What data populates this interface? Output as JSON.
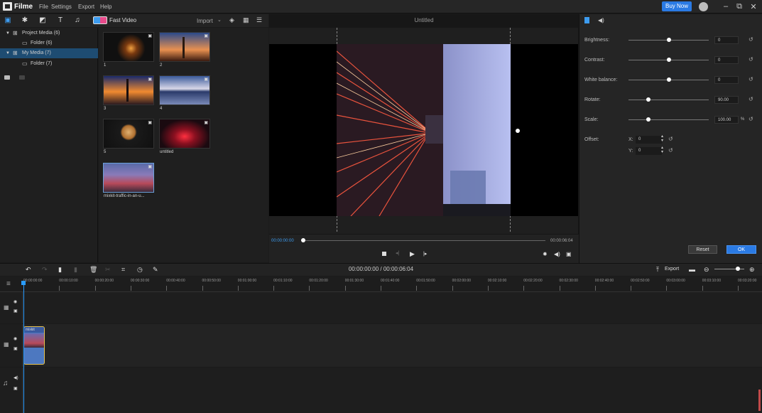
{
  "app": {
    "name": "Filme"
  },
  "menu": [
    {
      "label": "File"
    },
    {
      "label": "Settings"
    },
    {
      "label": "Export"
    },
    {
      "label": "Help"
    }
  ],
  "titlebar": {
    "buy_now": "Buy Now"
  },
  "library": {
    "fast_video": "Fast Video",
    "import": "Import",
    "tree": [
      {
        "label": "Project Media (6)",
        "indent": 0,
        "selected": false
      },
      {
        "label": "Folder (6)",
        "indent": 1,
        "selected": false
      },
      {
        "label": "My Media (7)",
        "indent": 0,
        "selected": true
      },
      {
        "label": "Folder (7)",
        "indent": 1,
        "selected": false
      }
    ],
    "media": [
      {
        "label": "1"
      },
      {
        "label": "2"
      },
      {
        "label": "3"
      },
      {
        "label": "4"
      },
      {
        "label": "5"
      },
      {
        "label": "untitled"
      },
      {
        "label": "mixkit-traffic-in-an-u..."
      }
    ]
  },
  "preview": {
    "title": "Untitled",
    "time_current": "00:00:00:00",
    "time_total": "00:00:06:04",
    "progress": 0.0
  },
  "properties": {
    "brightness": {
      "label": "Brightness:",
      "value": "0",
      "level": 0.5
    },
    "contrast": {
      "label": "Contrast:",
      "value": "0",
      "level": 0.5
    },
    "white_balance": {
      "label": "White balance:",
      "value": "0",
      "level": 0.5
    },
    "rotate": {
      "label": "Rotate:",
      "value": "90.00",
      "level": 0.25
    },
    "scale": {
      "label": "Scale:",
      "value": "100.00",
      "unit": "%",
      "level": 0.25
    },
    "offset": {
      "label": "Offset:",
      "x_label": "X:",
      "x_value": "0",
      "y_label": "Y:",
      "y_value": "0"
    },
    "reset": "Reset",
    "ok": "OK"
  },
  "timeline": {
    "timecode": "00:00:00:00 / 00:00:06:04",
    "export": "Export",
    "clip_label": "mixkit",
    "ruler": [
      "00:00:00:00",
      "00:00:10:00",
      "00:00:20:00",
      "00:00:30:00",
      "00:00:40:00",
      "00:00:50:00",
      "00:01:00:00",
      "00:01:10:00",
      "00:01:20:00",
      "00:01:30:00",
      "00:01:40:00",
      "00:01:50:00",
      "00:02:00:00",
      "00:02:10:00",
      "00:02:20:00",
      "00:02:30:00",
      "00:02:40:00",
      "00:02:50:00",
      "00:03:00:00",
      "00:03:10:00",
      "00:03:20:00"
    ]
  },
  "colors": {
    "accent": "#2a7ae4",
    "selection": "#1e4c72",
    "clip_border": "#e6c24f",
    "playhead": "#2a9cff"
  }
}
